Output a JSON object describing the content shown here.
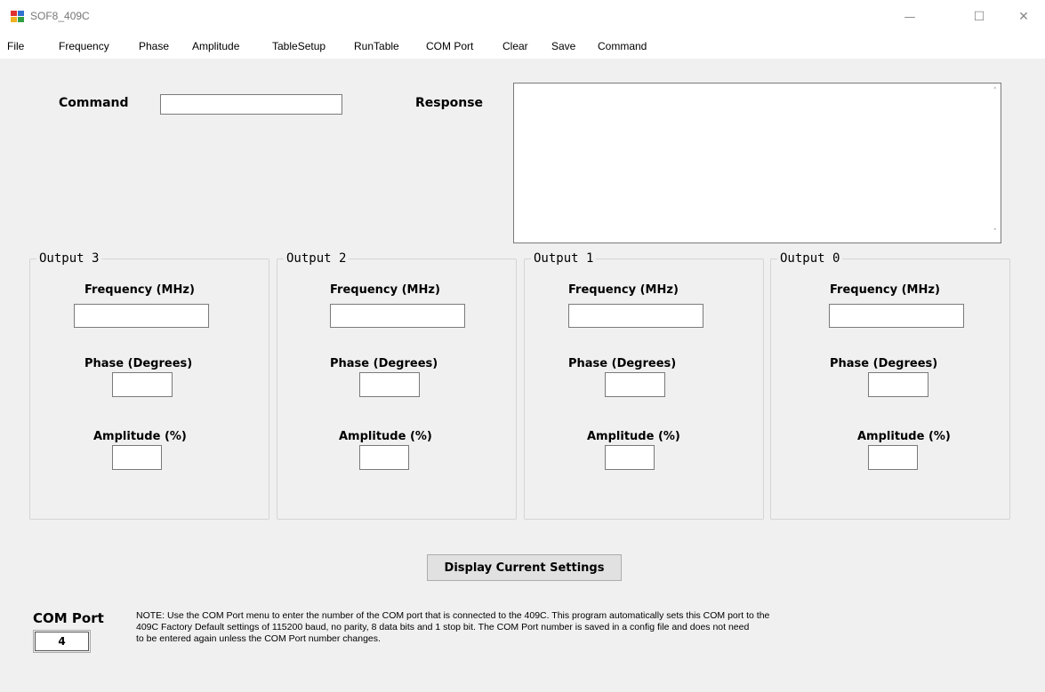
{
  "window": {
    "title": "SOF8_409C",
    "minimize_glyph": "—",
    "maximize_glyph": "☐",
    "close_glyph": "✕"
  },
  "menu": [
    "File",
    "Frequency",
    "Phase",
    "Amplitude",
    "TableSetup",
    "RunTable",
    "COM Port",
    "Clear",
    "Save",
    "Command"
  ],
  "command": {
    "label": "Command",
    "value": ""
  },
  "response": {
    "label": "Response",
    "value": ""
  },
  "outputs": [
    {
      "title": "Output 3",
      "freq_label": "Frequency (MHz)",
      "phase_label": "Phase (Degrees)",
      "amp_label": "Amplitude (%)",
      "freq": "",
      "phase": "",
      "amp": ""
    },
    {
      "title": "Output 2",
      "freq_label": "Frequency (MHz)",
      "phase_label": "Phase (Degrees)",
      "amp_label": "Amplitude (%)",
      "freq": "",
      "phase": "",
      "amp": ""
    },
    {
      "title": "Output 1",
      "freq_label": "Frequency (MHz)",
      "phase_label": "Phase (Degrees)",
      "amp_label": "Amplitude (%)",
      "freq": "",
      "phase": "",
      "amp": ""
    },
    {
      "title": "Output 0",
      "freq_label": "Frequency (MHz)",
      "phase_label": "Phase (Degrees)",
      "amp_label": "Amplitude (%)",
      "freq": "",
      "phase": "",
      "amp": ""
    }
  ],
  "display_button": "Display Current Settings",
  "com_port": {
    "label": "COM Port",
    "value": "4"
  },
  "note": [
    "NOTE: Use the COM Port menu to enter the number of the COM port that is connected to the 409C.  This program automatically sets this COM port to the",
    "409C Factory Default settings of 115200 baud, no parity, 8 data bits and  1 stop bit.  The COM Port number is saved in a config file and does not need",
    "to be entered again unless the COM Port number changes."
  ]
}
